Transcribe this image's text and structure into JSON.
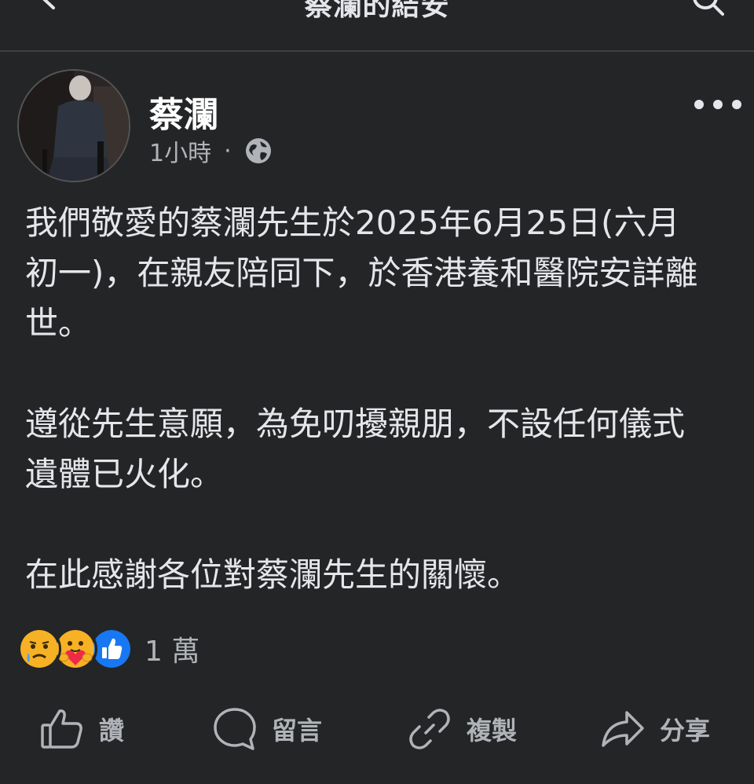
{
  "header": {
    "title": "蔡瀾的結安"
  },
  "post": {
    "author": "蔡瀾",
    "time": "1小時",
    "separator": "·",
    "privacy_icon": "globe-icon",
    "more_icon": "more-dots-icon",
    "paragraphs": [
      [
        "我們敬愛的蔡瀾先生於2025年6月25日(六月",
        "初一)，在親友陪同下，於香港養和醫院安詳離",
        "世。"
      ],
      [
        "遵從先生意願，為免叨擾親朋，不設任何儀式",
        "遺體已火化。"
      ],
      [
        "在此感謝各位對蔡瀾先生的關懷。"
      ]
    ]
  },
  "reactions": {
    "icons": [
      "sad-reaction-icon",
      "care-reaction-icon",
      "like-reaction-icon"
    ],
    "count": "1 萬"
  },
  "actions": {
    "like": "讚",
    "comment": "留言",
    "copy": "複製",
    "share": "分享"
  },
  "colors": {
    "background": "#242526",
    "text": "#e4e6eb",
    "secondary": "#b0b3b8",
    "like_blue": "#1877f2"
  }
}
